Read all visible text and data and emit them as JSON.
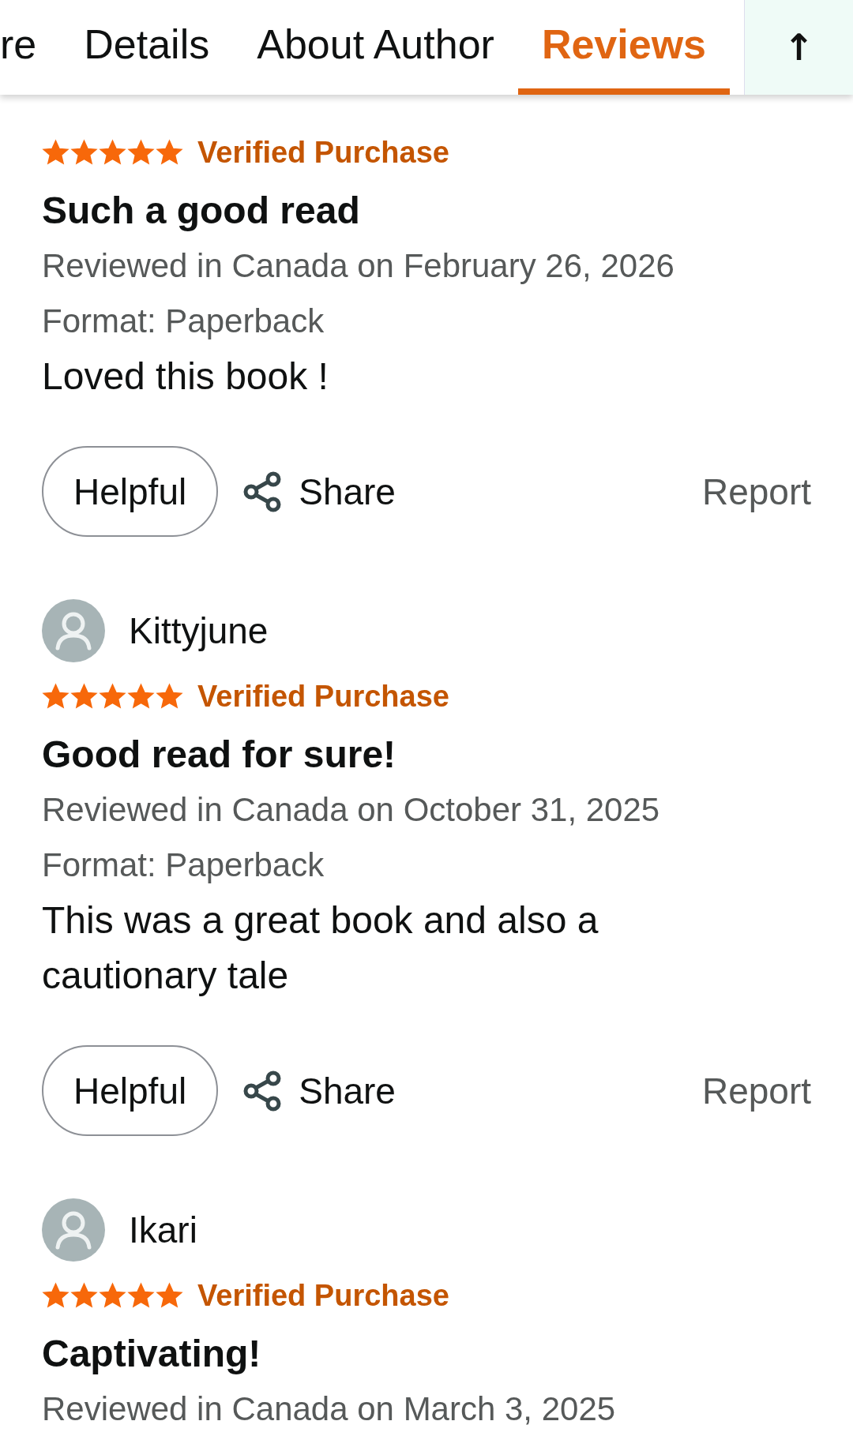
{
  "tabs": [
    {
      "label": "re",
      "selected": false
    },
    {
      "label": "Details",
      "selected": false
    },
    {
      "label": "About Author",
      "selected": false
    },
    {
      "label": "Reviews",
      "selected": true
    }
  ],
  "scroll_top_button": {
    "label": "↑"
  },
  "reviews": [
    {
      "stars": 5,
      "badge": "Verified Purchase",
      "title": "Such a good read",
      "meta": "Reviewed in Canada on February 26, 2026",
      "format": "Format: Paperback",
      "body": "Loved this book !",
      "actions": {
        "helpful": "Helpful",
        "share": "Share",
        "report": "Report"
      }
    },
    {
      "reviewer": "Kittyjune",
      "stars": 5,
      "badge": "Verified Purchase",
      "title": "Good read for sure!",
      "meta": "Reviewed in Canada on October 31, 2025",
      "format": "Format: Paperback",
      "body": "This was a great book and also a cautionary tale",
      "actions": {
        "helpful": "Helpful",
        "share": "Share",
        "report": "Report"
      }
    },
    {
      "reviewer": "Ikari",
      "stars": 5,
      "badge": "Verified Purchase",
      "title": "Captivating!",
      "meta": "Reviewed in Canada on March 3, 2025"
    }
  ]
}
